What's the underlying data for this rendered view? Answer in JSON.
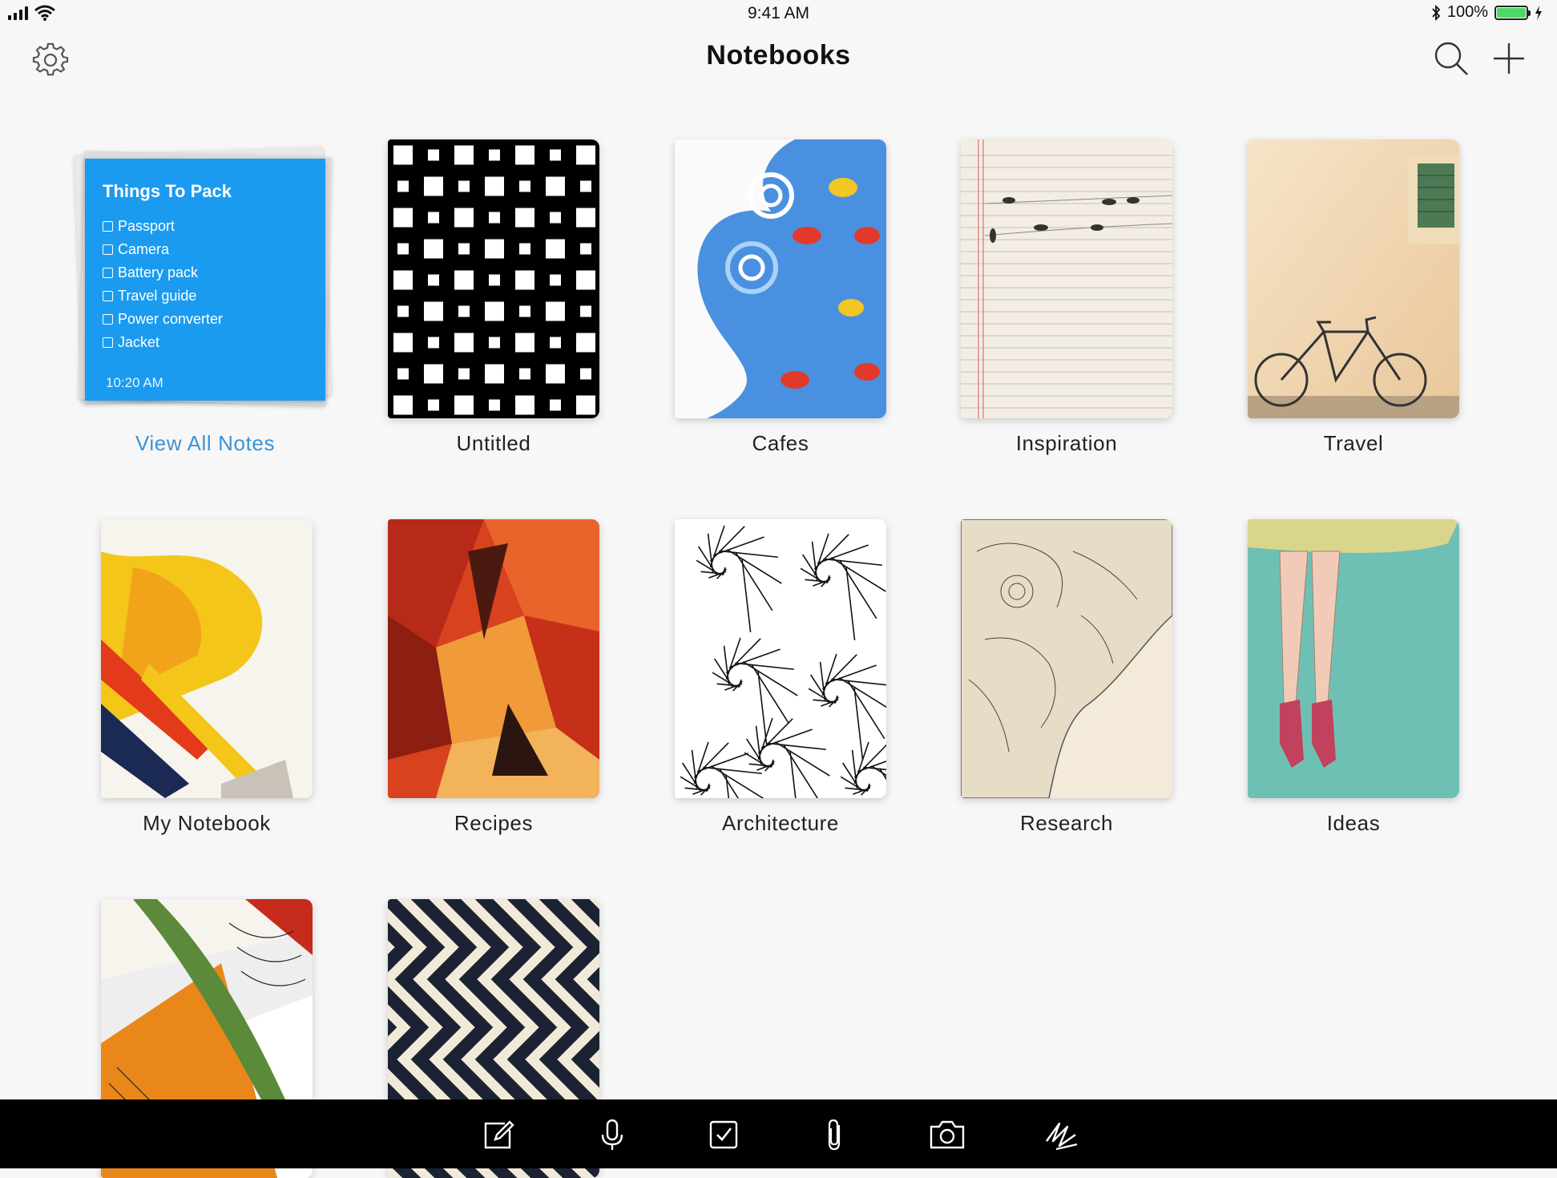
{
  "status_bar": {
    "time": "9:41 AM",
    "battery_percent": "100%",
    "battery_level": 1.0,
    "battery_color": "#4cd964",
    "icons": [
      "signal-icon",
      "wifi-icon",
      "bluetooth-icon",
      "battery-icon",
      "charging-icon"
    ]
  },
  "nav": {
    "title": "Notebooks",
    "icons": [
      "gear-icon",
      "search-icon",
      "plus-icon"
    ]
  },
  "notes_card": {
    "title": "Things To Pack",
    "items": [
      "Passport",
      "Camera",
      "Battery pack",
      "Travel guide",
      "Power converter",
      "Jacket"
    ],
    "time": "10:20 AM",
    "color": "#1a9bf0",
    "link": "View All Notes",
    "link_color": "#3a93d6"
  },
  "notebooks": [
    {
      "label": "Untitled",
      "cover": "checker-pattern"
    },
    {
      "label": "Cafes",
      "cover": "blue-wave-fish"
    },
    {
      "label": "Inspiration",
      "cover": "lined-paper-birds"
    },
    {
      "label": "Travel",
      "cover": "bicycle-wall"
    },
    {
      "label": "My Notebook",
      "cover": "yellow-abstract-paint"
    },
    {
      "label": "Recipes",
      "cover": "red-geometric-paint"
    },
    {
      "label": "Architecture",
      "cover": "line-spiral-pattern"
    },
    {
      "label": "Research",
      "cover": "elephant-sketch"
    },
    {
      "label": "Ideas",
      "cover": "ballerina-feet"
    },
    {
      "label": "",
      "cover": "leaf-abstract"
    },
    {
      "label": "",
      "cover": "maze-pattern"
    }
  ],
  "toolbar": {
    "icons": [
      "compose-icon",
      "microphone-icon",
      "checklist-icon",
      "paperclip-icon",
      "camera-icon",
      "scribble-icon"
    ]
  }
}
